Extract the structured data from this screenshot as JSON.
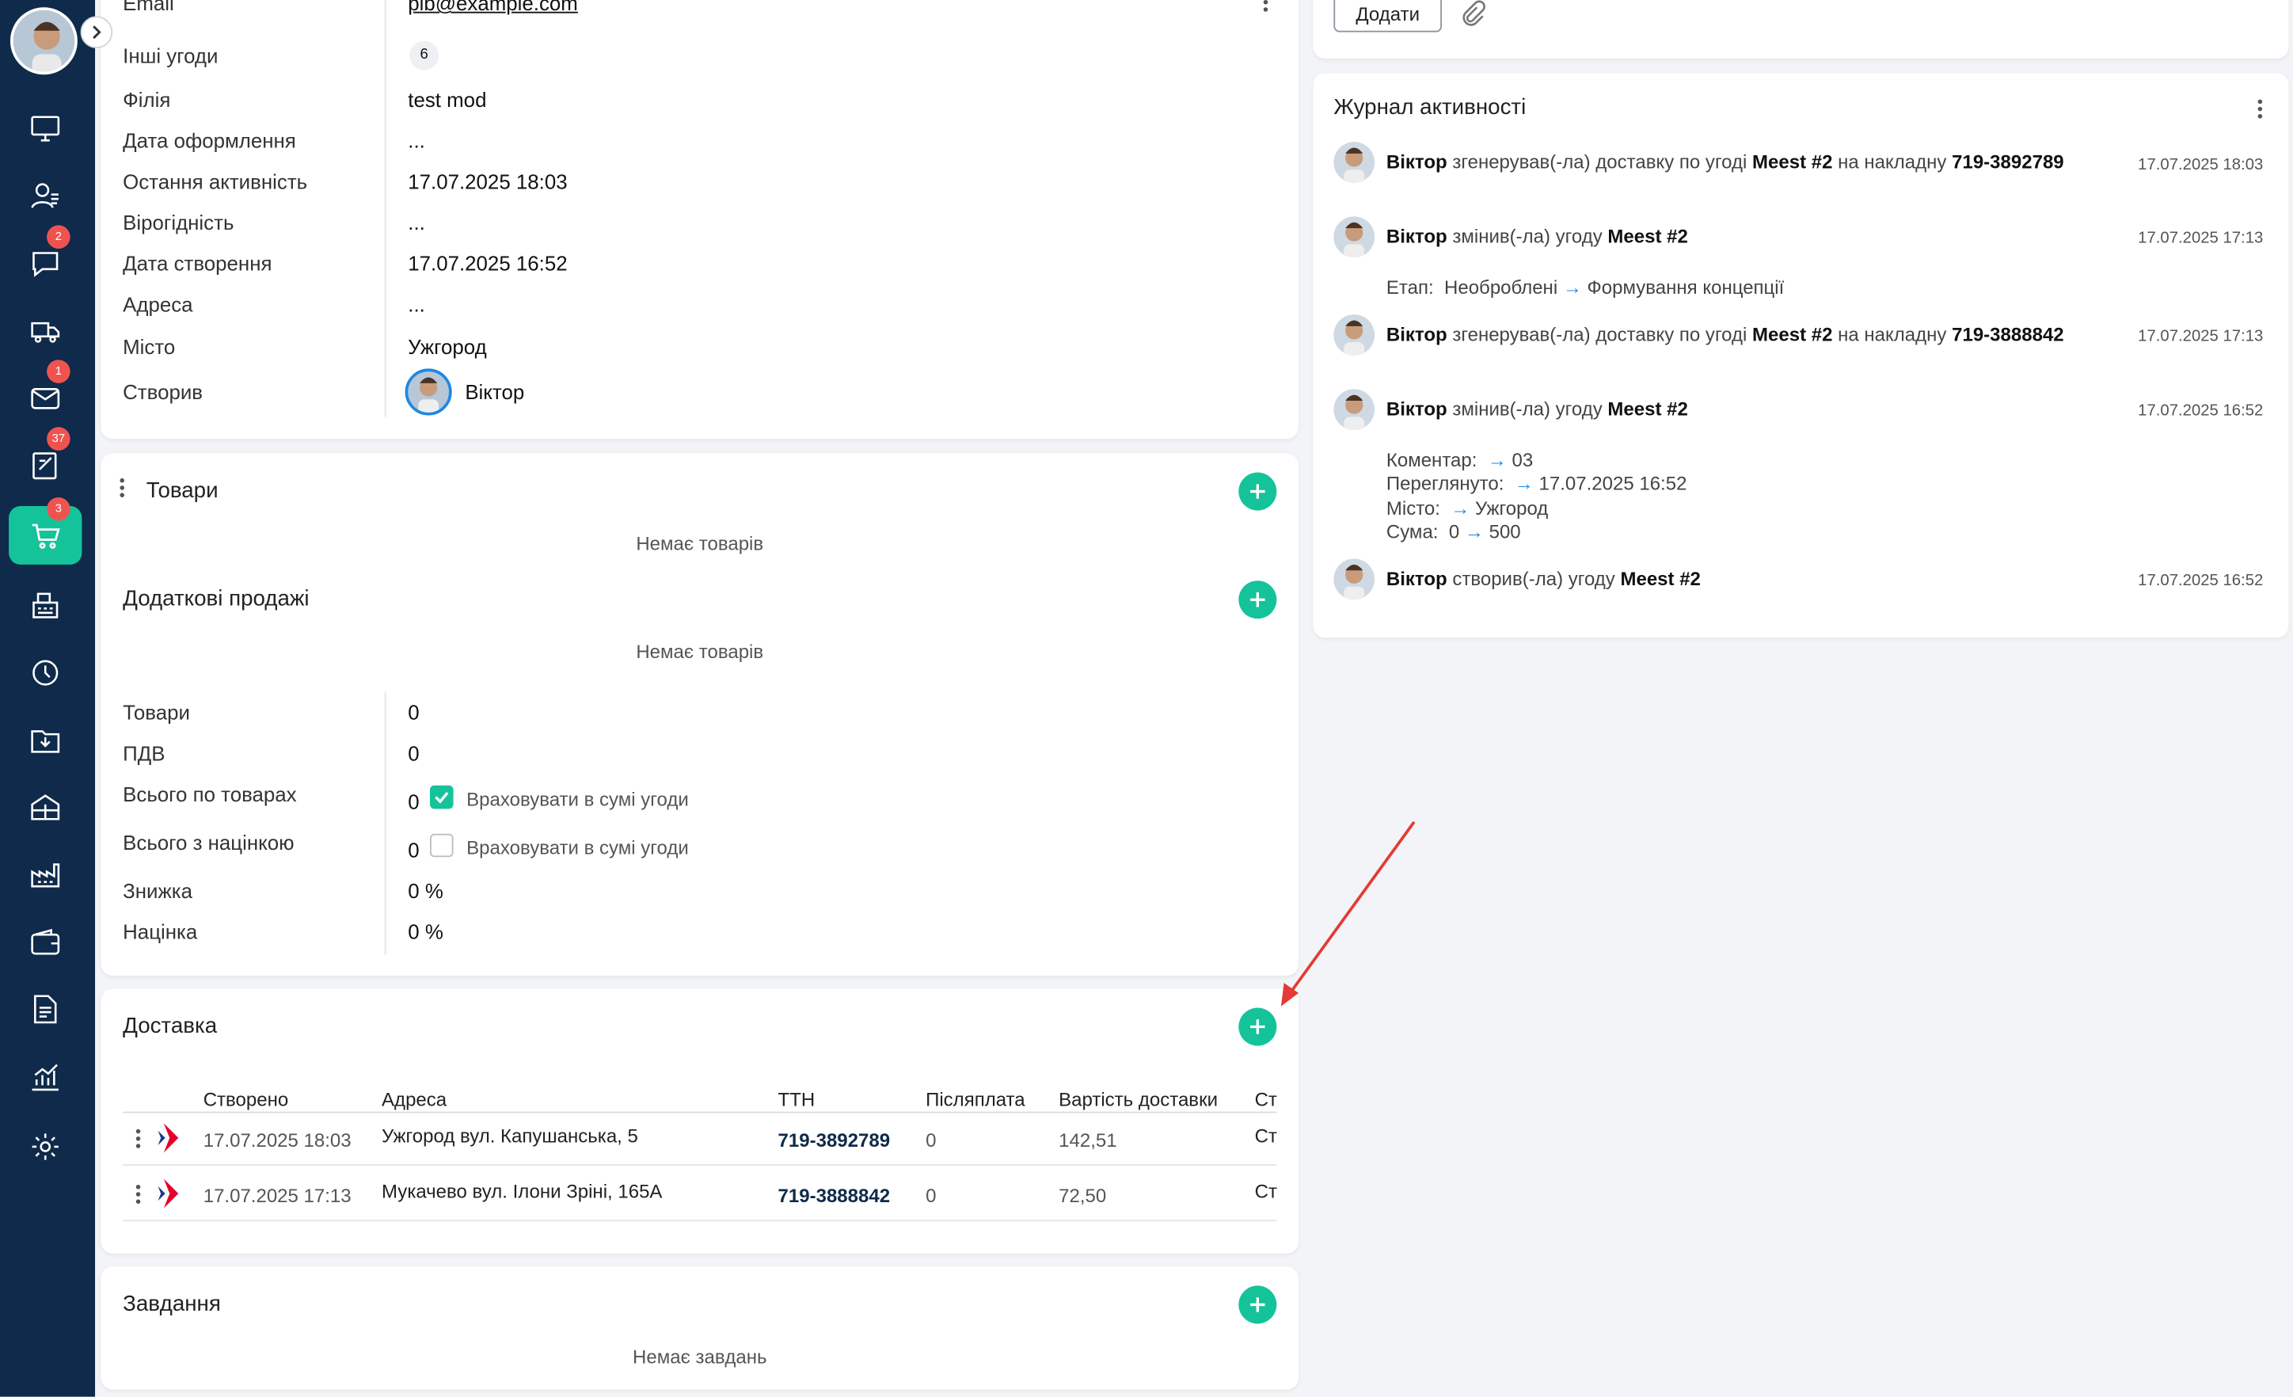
{
  "sidebar": {
    "badges": {
      "chat": "2",
      "mail": "1",
      "notes": "37",
      "cart": "3"
    },
    "icons": [
      "monitor-icon",
      "contacts-icon",
      "chat-icon",
      "truck-icon",
      "mail-icon",
      "notes-icon",
      "cart-icon",
      "cash-register-icon",
      "clock-icon",
      "folder-download-icon",
      "warehouse-icon",
      "factory-icon",
      "wallet-icon",
      "document-icon",
      "chart-icon",
      "gear-icon"
    ]
  },
  "details": {
    "rows": [
      {
        "label": "Email",
        "value": "pib@example.com"
      },
      {
        "label": "Інші угоди",
        "value": "6"
      },
      {
        "label": "Філія",
        "value": "test mod"
      },
      {
        "label": "Дата оформлення",
        "value": "..."
      },
      {
        "label": "Остання активність",
        "value": "17.07.2025 18:03"
      },
      {
        "label": "Вірогідність",
        "value": "..."
      },
      {
        "label": "Дата створення",
        "value": "17.07.2025 16:52"
      },
      {
        "label": "Адреса",
        "value": "..."
      },
      {
        "label": "Місто",
        "value": "Ужгород"
      },
      {
        "label": "Створив",
        "value": "Віктор"
      }
    ]
  },
  "products": {
    "title": "Товари",
    "empty": "Немає товарів",
    "extra_title": "Додаткові продажі",
    "extra_empty": "Немає товарів",
    "summary": [
      {
        "label": "Товари",
        "value": "0"
      },
      {
        "label": "ПДВ",
        "value": "0"
      },
      {
        "label": "Всього по товарах",
        "value": "0",
        "checkbox_label": "Враховувати в сумі угоди",
        "checked": true
      },
      {
        "label": "Всього з націнкою",
        "value": "0",
        "checkbox_label": "Враховувати в сумі угоди",
        "checked": false
      },
      {
        "label": "Знижка",
        "value": "0 %"
      },
      {
        "label": "Націнка",
        "value": "0 %"
      }
    ]
  },
  "delivery": {
    "title": "Доставка",
    "columns": [
      "Створено",
      "Адреса",
      "ТТН",
      "Післяплата",
      "Вартість доставки",
      "Ст"
    ],
    "rows": [
      {
        "created": "17.07.2025 18:03",
        "address": "Ужгород вул. Капушанська, 5",
        "ttn": "719-3892789",
        "cod": "0",
        "cost": "142,51",
        "status": "Ст"
      },
      {
        "created": "17.07.2025 17:13",
        "address": "Мукачево вул. Ілони Зріні, 165А",
        "ttn": "719-3888842",
        "cod": "0",
        "cost": "72,50",
        "status": "Ст"
      }
    ]
  },
  "tasks": {
    "title": "Завдання",
    "empty": "Немає завдань"
  },
  "comment": {
    "add_label": "Додати"
  },
  "activity": {
    "title": "Журнал активності",
    "entries": [
      {
        "name": "Віктор",
        "pre": " згенерував(-ла) доставку по угоді ",
        "obj": "Meest #2",
        "mid": " на накладну ",
        "obj2": "719-3892789",
        "time": "17.07.2025 18:03"
      },
      {
        "name": "Віктор",
        "pre": " змінив(-ла) угоду ",
        "obj": "Meest #2",
        "mid": "",
        "obj2": "",
        "time": "17.07.2025 17:13",
        "details": [
          {
            "label": "Етап:",
            "from": "Необроблені",
            "to": "Формування концепції"
          }
        ]
      },
      {
        "name": "Віктор",
        "pre": " згенерував(-ла) доставку по угоді ",
        "obj": "Meest #2",
        "mid": " на накладну ",
        "obj2": "719-3888842",
        "time": "17.07.2025 17:13"
      },
      {
        "name": "Віктор",
        "pre": " змінив(-ла) угоду ",
        "obj": "Meest #2",
        "mid": "",
        "obj2": "",
        "time": "17.07.2025 16:52",
        "details": [
          {
            "label": "Коментар:",
            "from": "",
            "to": "03"
          },
          {
            "label": "Переглянуто:",
            "from": "",
            "to": "17.07.2025 16:52"
          },
          {
            "label": "Місто:",
            "from": "",
            "to": "Ужгород"
          },
          {
            "label": "Сума:",
            "from": "0",
            "to": "500"
          }
        ]
      },
      {
        "name": "Віктор",
        "pre": " створив(-ла) угоду ",
        "obj": "Meest #2",
        "mid": "",
        "obj2": "",
        "time": "17.07.2025 16:52"
      }
    ]
  },
  "colors": {
    "accent": "#15c39a",
    "sidebar": "#0f2a4a",
    "badge": "#ef5350",
    "link_arrow": "#1e88e5",
    "annotation": "#e53935"
  }
}
